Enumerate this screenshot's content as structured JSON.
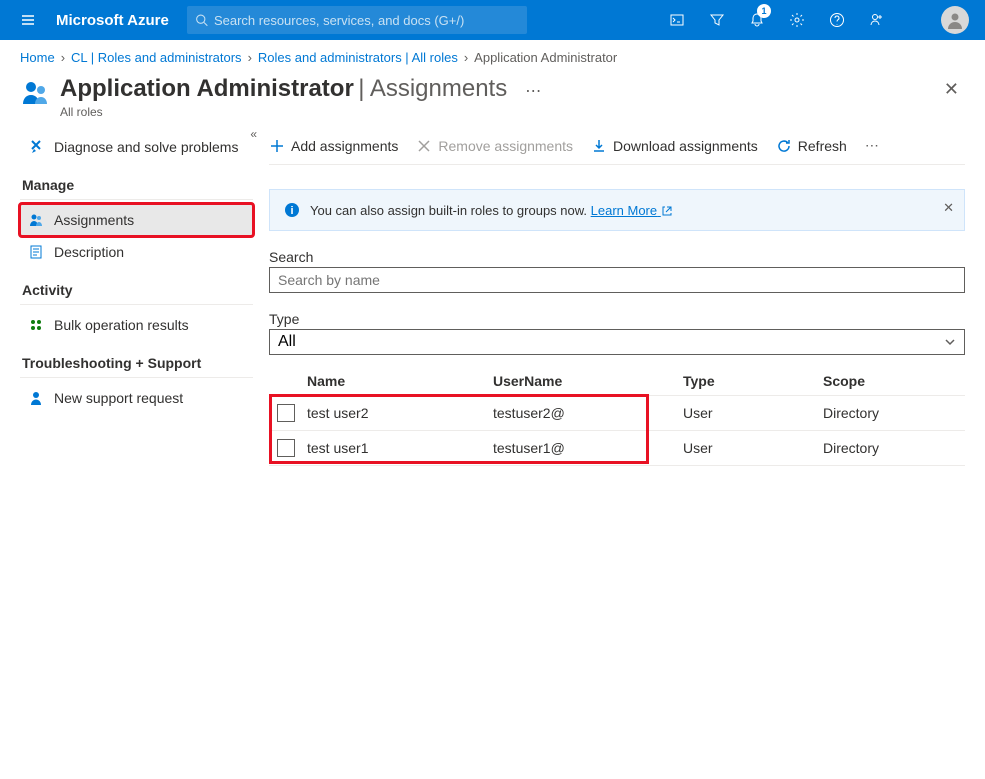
{
  "topbar": {
    "brand": "Microsoft Azure",
    "search_placeholder": "Search resources, services, and docs (G+/)",
    "notification_count": "1"
  },
  "breadcrumb": {
    "items": [
      {
        "label": "Home"
      },
      {
        "label": "CL | Roles and administrators"
      },
      {
        "label": "Roles and administrators | All roles"
      },
      {
        "label": "Application Administrator",
        "current": true
      }
    ]
  },
  "header": {
    "main_title": "Application Administrator",
    "section": "Assignments",
    "subtitle": "All roles"
  },
  "sidebar": {
    "diagnose": "Diagnose and solve problems",
    "sections": {
      "manage": "Manage",
      "activity": "Activity",
      "troubleshoot": "Troubleshooting + Support"
    },
    "items": {
      "assignments": "Assignments",
      "description": "Description",
      "bulk": "Bulk operation results",
      "support": "New support request"
    }
  },
  "toolbar": {
    "add": "Add assignments",
    "remove": "Remove assignments",
    "download": "Download assignments",
    "refresh": "Refresh"
  },
  "banner": {
    "text": "You can also assign built-in roles to groups now. ",
    "link": "Learn More"
  },
  "filters": {
    "search_label": "Search",
    "search_placeholder": "Search by name",
    "type_label": "Type",
    "type_value": "All"
  },
  "table": {
    "headers": {
      "name": "Name",
      "username": "UserName",
      "type": "Type",
      "scope": "Scope"
    },
    "rows": [
      {
        "name": "test user2",
        "username": "testuser2@",
        "type": "User",
        "scope": "Directory"
      },
      {
        "name": "test user1",
        "username": "testuser1@",
        "type": "User",
        "scope": "Directory"
      }
    ]
  }
}
